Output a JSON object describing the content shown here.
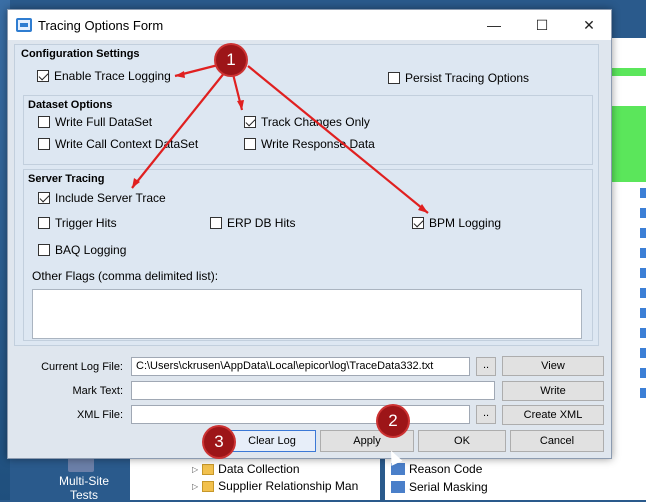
{
  "window": {
    "title": "Tracing Options Form",
    "min": "—",
    "max": "☐",
    "close": "✕"
  },
  "config": {
    "title": "Configuration Settings",
    "enable_trace": {
      "label": "Enable Trace Logging",
      "checked": true
    },
    "persist": {
      "label": "Persist Tracing Options",
      "checked": false
    }
  },
  "dataset": {
    "title": "Dataset Options",
    "full": {
      "label": "Write Full DataSet",
      "checked": false
    },
    "track": {
      "label": "Track Changes Only",
      "checked": true
    },
    "call_ctx": {
      "label": "Write Call Context DataSet",
      "checked": false
    },
    "response": {
      "label": "Write Response Data",
      "checked": false
    }
  },
  "server": {
    "title": "Server Tracing",
    "include": {
      "label": "Include Server Trace",
      "checked": true
    },
    "trigger": {
      "label": "Trigger Hits",
      "checked": false
    },
    "erp": {
      "label": "ERP DB Hits",
      "checked": false
    },
    "bpm": {
      "label": "BPM Logging",
      "checked": true
    },
    "baq": {
      "label": "BAQ Logging",
      "checked": false
    },
    "flags_label": "Other Flags (comma delimited list):",
    "flags_value": ""
  },
  "files": {
    "log_label": "Current Log File:",
    "log_value": "C:\\Users\\ckrusen\\AppData\\Local\\epicor\\log\\TraceData332.txt",
    "mark_label": "Mark Text:",
    "mark_value": "",
    "xml_label": "XML File:",
    "xml_value": "",
    "browse": "..",
    "view": "View",
    "write": "Write",
    "create_xml": "Create XML"
  },
  "buttons": {
    "clear_log": "Clear Log",
    "apply": "Apply",
    "ok": "OK",
    "cancel": "Cancel"
  },
  "annotations": {
    "one": "1",
    "two": "2",
    "three": "3",
    "arrow_color": "#e02020",
    "badge_color": "#9d1518"
  },
  "background": {
    "desktop_label": "Multi-Site Tests",
    "tree_left": [
      "Data Collection",
      "Supplier Relationship Man"
    ],
    "tree_right": [
      "Reason Code",
      "Serial Masking"
    ]
  }
}
